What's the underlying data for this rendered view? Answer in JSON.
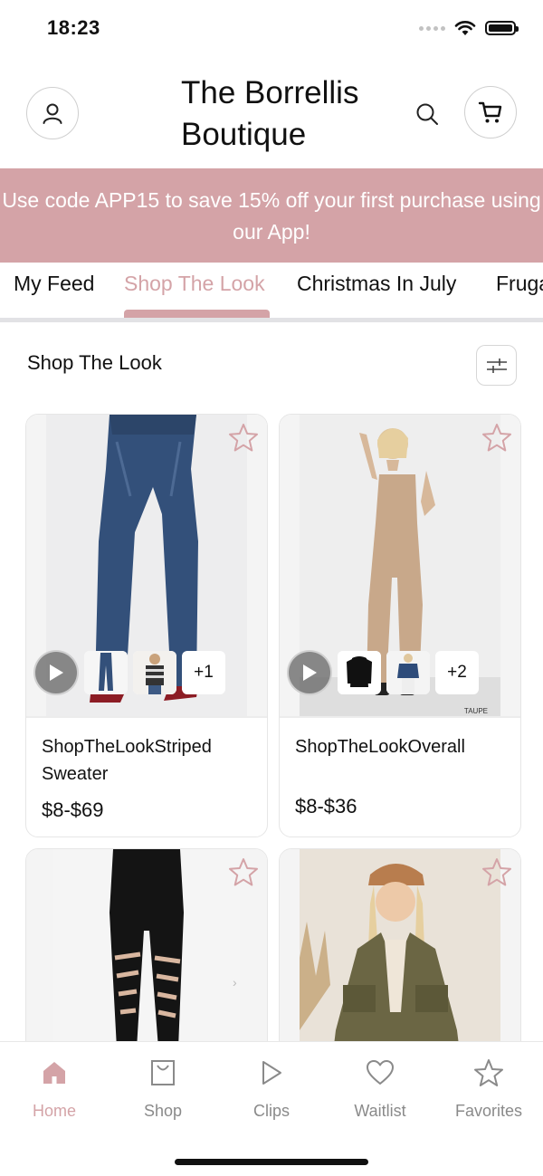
{
  "status_bar": {
    "time": "18:23"
  },
  "header": {
    "title": "The Borrellis Boutique",
    "profile_icon": "user-icon",
    "search_icon": "search-icon",
    "cart_icon": "cart-icon"
  },
  "promo": {
    "text": "Use code APP15 to save 15% off your first purchase using our App!"
  },
  "tabs": [
    {
      "label": "My Feed",
      "active": false
    },
    {
      "label": "Shop The Look",
      "active": true
    },
    {
      "label": "Christmas In July",
      "active": false
    },
    {
      "label": "Frugal",
      "active": false
    }
  ],
  "section": {
    "title": "Shop The Look",
    "filter_icon": "sliders-icon"
  },
  "products": [
    {
      "name": "ShopTheLookStriped Sweater",
      "price": "$8-$69",
      "more_count": "+1",
      "image": "dark-wash-jeans"
    },
    {
      "name": "ShopTheLookOverall",
      "price": "$8-$36",
      "more_count": "+2",
      "image": "taupe-overall"
    },
    {
      "name": "",
      "price": "",
      "image": "distressed-black-leggings"
    },
    {
      "name": "",
      "price": "",
      "image": "olive-jacket"
    }
  ],
  "image_label": "TAUPE",
  "bottom_nav": [
    {
      "label": "Home",
      "icon": "home-icon",
      "active": true
    },
    {
      "label": "Shop",
      "icon": "bag-icon",
      "active": false
    },
    {
      "label": "Clips",
      "icon": "play-icon",
      "active": false
    },
    {
      "label": "Waitlist",
      "icon": "heart-icon",
      "active": false
    },
    {
      "label": "Favorites",
      "icon": "star-icon",
      "active": false
    }
  ],
  "colors": {
    "accent": "#d4a3a7",
    "text": "#111111",
    "muted": "#8a8a8a"
  }
}
